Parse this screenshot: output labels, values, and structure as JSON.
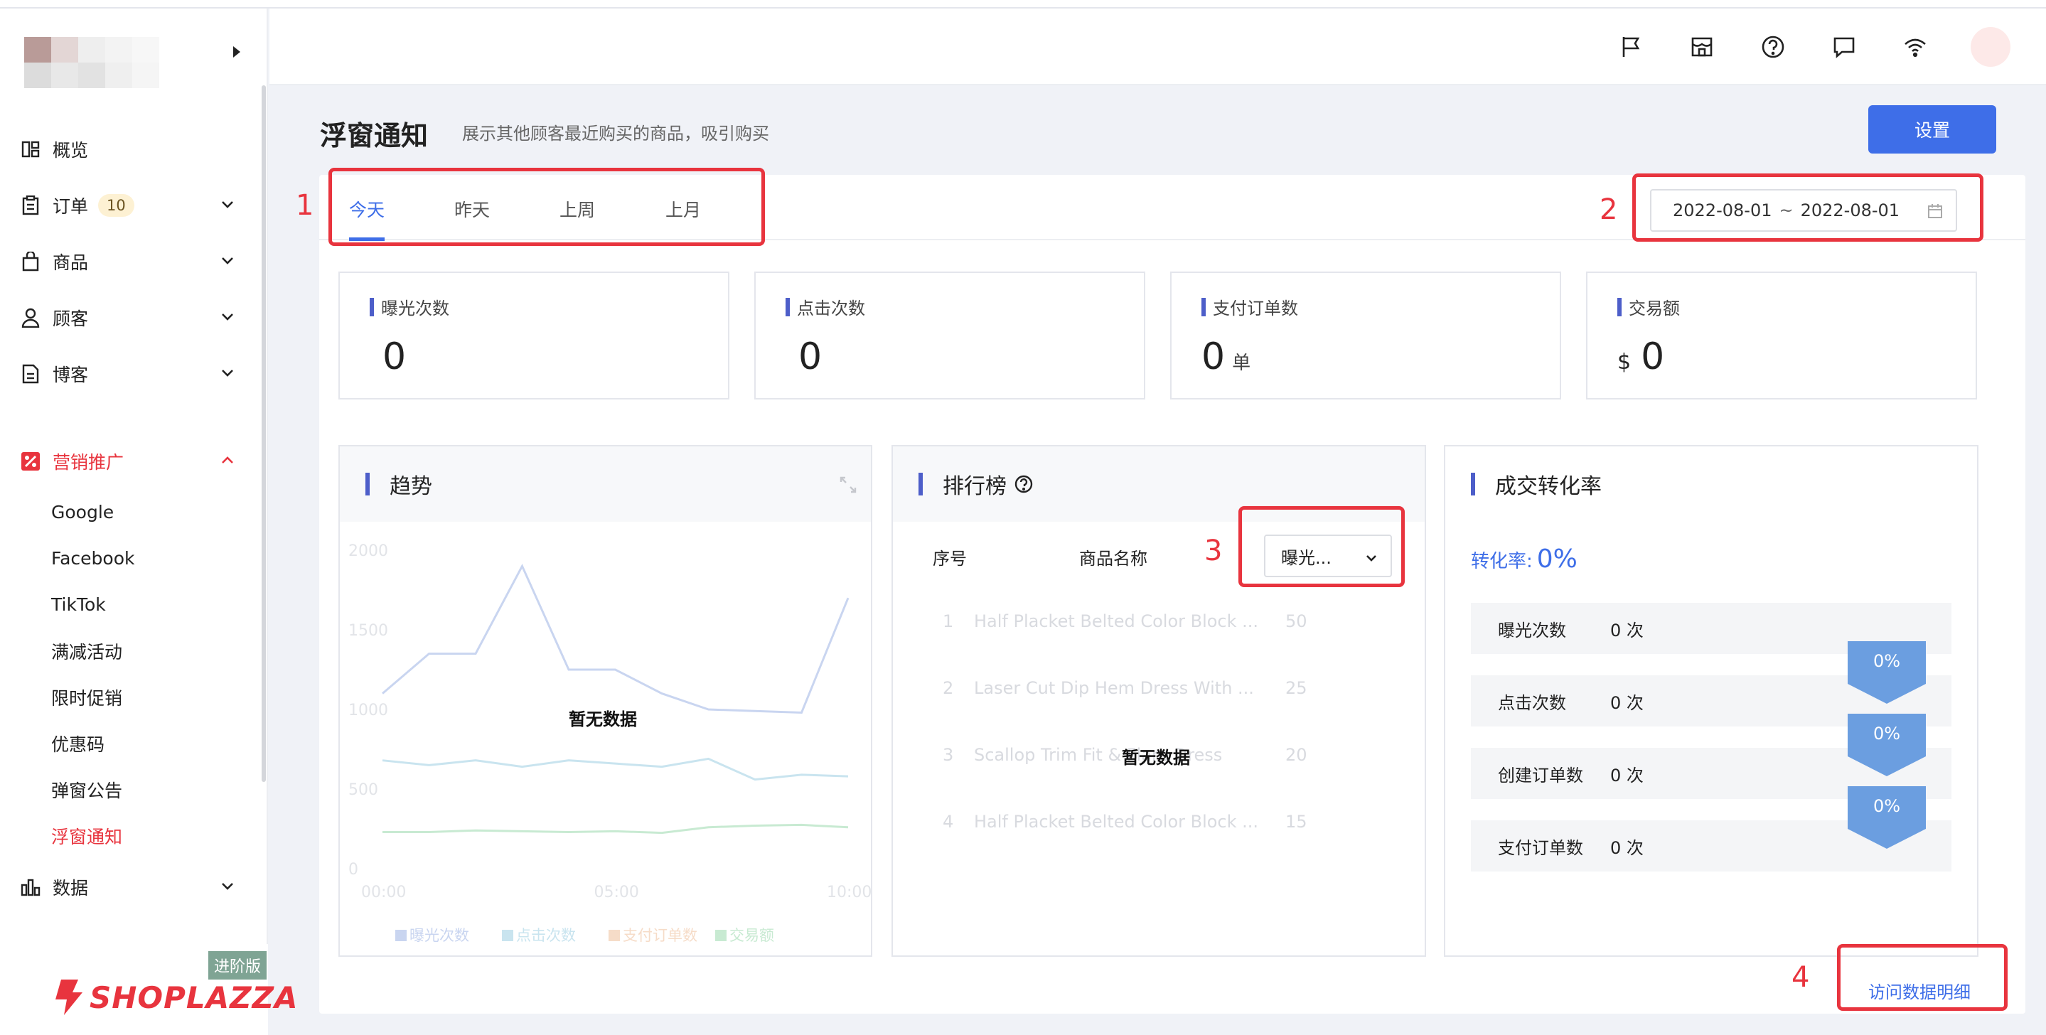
{
  "sidebar": {
    "items": [
      {
        "label": "概览",
        "icon": "overview-icon"
      },
      {
        "label": "订单",
        "icon": "order-icon",
        "badge": "10"
      },
      {
        "label": "商品",
        "icon": "product-icon"
      },
      {
        "label": "顾客",
        "icon": "customer-icon"
      },
      {
        "label": "博客",
        "icon": "blog-icon"
      }
    ],
    "marketing": {
      "label": "营销推广",
      "icon": "marketing-icon",
      "sub_items": [
        "Google",
        "Facebook",
        "TikTok",
        "满减活动",
        "限时促销",
        "优惠码",
        "弹窗公告",
        "浮窗通知"
      ],
      "active_sub": "浮窗通知"
    },
    "data_item": {
      "label": "数据",
      "icon": "data-chart-icon"
    },
    "plan_badge": "进阶版",
    "brand": "SHOPLAZZA"
  },
  "header": {
    "icons": [
      "flag-icon",
      "store-icon",
      "help-icon",
      "message-icon",
      "wifi-icon"
    ]
  },
  "page": {
    "title": "浮窗通知",
    "description": "展示其他顾客最近购买的商品，吸引购买",
    "settings_label": "设置"
  },
  "tabs": [
    "今天",
    "昨天",
    "上周",
    "上月"
  ],
  "date_range": {
    "start": "2022-08-01",
    "sep": "~",
    "end": "2022-08-01"
  },
  "annotations": [
    "1",
    "2",
    "3",
    "4"
  ],
  "stats": [
    {
      "label": "曝光次数",
      "prefix": "",
      "value": "0",
      "suffix": ""
    },
    {
      "label": "点击次数",
      "prefix": "",
      "value": "0",
      "suffix": ""
    },
    {
      "label": "支付订单数",
      "prefix": "",
      "value": "0",
      "suffix": "单"
    },
    {
      "label": "交易额",
      "prefix": "$",
      "value": "0",
      "suffix": ""
    }
  ],
  "trend": {
    "title": "趋势",
    "no_data": "暂无数据"
  },
  "chart_data": {
    "type": "line",
    "title": "趋势",
    "x_ticks": [
      "00:00",
      "05:00",
      "10:00"
    ],
    "ylim": [
      0,
      2000
    ],
    "y_ticks": [
      "2000",
      "1500",
      "1000",
      "500",
      "0"
    ],
    "x": [
      0,
      1,
      2,
      3,
      4,
      5,
      6,
      7,
      8,
      9,
      10
    ],
    "series": [
      {
        "name": "曝光次数",
        "color": "#c9d5f0",
        "values": [
          1100,
          1350,
          1350,
          1900,
          1250,
          1250,
          1100,
          1000,
          990,
          980,
          1700
        ]
      },
      {
        "name": "点击次数",
        "color": "#c9e4ef",
        "values": [
          680,
          650,
          680,
          640,
          680,
          660,
          640,
          690,
          560,
          590,
          580
        ]
      },
      {
        "name": "支付订单数",
        "color": "#f6dcc8",
        "values": [],
        "_note": "legend only"
      },
      {
        "name": "交易额",
        "color": "#c8ead2",
        "values": [
          230,
          230,
          240,
          235,
          230,
          235,
          225,
          260,
          270,
          275,
          260
        ]
      }
    ],
    "legend_position": "bottom",
    "grid": false
  },
  "ranking": {
    "title": "排行榜",
    "col_no": "序号",
    "col_name": "商品名称",
    "select_value": "曝光...",
    "no_data": "暂无数据",
    "rows": [
      {
        "no": "1",
        "name": "Half Placket Belted Color Block ...",
        "value": "50"
      },
      {
        "no": "2",
        "name": "Laser Cut Dip Hem Dress With ...",
        "value": "25"
      },
      {
        "no": "3",
        "name": "Scallop Trim Fit & Flare Dress",
        "value": "20"
      },
      {
        "no": "4",
        "name": "Half Placket Belted Color Block ...",
        "value": "15"
      }
    ]
  },
  "conversion": {
    "title": "成交转化率",
    "rate_label": "转化率:",
    "rate_value": "0%",
    "funnel": [
      {
        "label": "曝光次数",
        "value": "0 次"
      },
      {
        "label": "点击次数",
        "value": "0 次"
      },
      {
        "label": "创建订单数",
        "value": "0 次"
      },
      {
        "label": "支付订单数",
        "value": "0 次"
      }
    ],
    "arrows": [
      "0%",
      "0%",
      "0%"
    ]
  },
  "visit_link": "访问数据明细",
  "colors": {
    "accent": "#3e6ee8",
    "brand_red": "#e8343e",
    "bar_indicator": "#4d5ec9",
    "funnel_arrow": "#6b9ee0"
  }
}
